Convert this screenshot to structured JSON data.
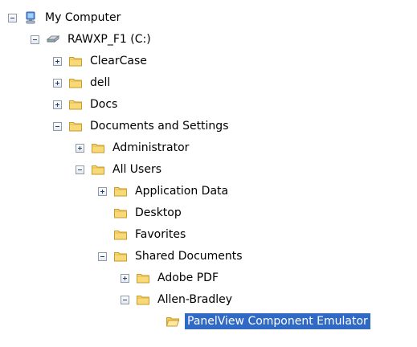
{
  "tree": {
    "selected_label": "PanelView Component Emulator",
    "items": [
      {
        "label": "My Computer",
        "icon": "computer-icon",
        "state": "expanded"
      },
      {
        "label": "RAWXP_F1 (C:)",
        "icon": "hard-drive-icon",
        "state": "expanded"
      },
      {
        "label": "ClearCase",
        "icon": "folder-icon",
        "state": "collapsed"
      },
      {
        "label": "dell",
        "icon": "folder-icon",
        "state": "collapsed"
      },
      {
        "label": "Docs",
        "icon": "folder-icon",
        "state": "collapsed"
      },
      {
        "label": "Documents and Settings",
        "icon": "folder-icon",
        "state": "expanded"
      },
      {
        "label": "Administrator",
        "icon": "folder-icon",
        "state": "collapsed"
      },
      {
        "label": "All Users",
        "icon": "folder-icon",
        "state": "expanded"
      },
      {
        "label": "Application Data",
        "icon": "folder-icon",
        "state": "collapsed"
      },
      {
        "label": "Desktop",
        "icon": "folder-icon",
        "state": "leaf"
      },
      {
        "label": "Favorites",
        "icon": "folder-icon",
        "state": "leaf"
      },
      {
        "label": "Shared Documents",
        "icon": "folder-icon",
        "state": "expanded"
      },
      {
        "label": "Adobe PDF",
        "icon": "folder-icon",
        "state": "collapsed"
      },
      {
        "label": "Allen-Bradley",
        "icon": "folder-icon",
        "state": "expanded"
      },
      {
        "label": "PanelView Component Emulator",
        "icon": "open-folder-icon",
        "state": "selected"
      }
    ]
  },
  "colors": {
    "selection": "#316ac5",
    "selection_text": "#ffffff",
    "folder_fill": "#f7d978",
    "folder_edge": "#c79b2c"
  }
}
